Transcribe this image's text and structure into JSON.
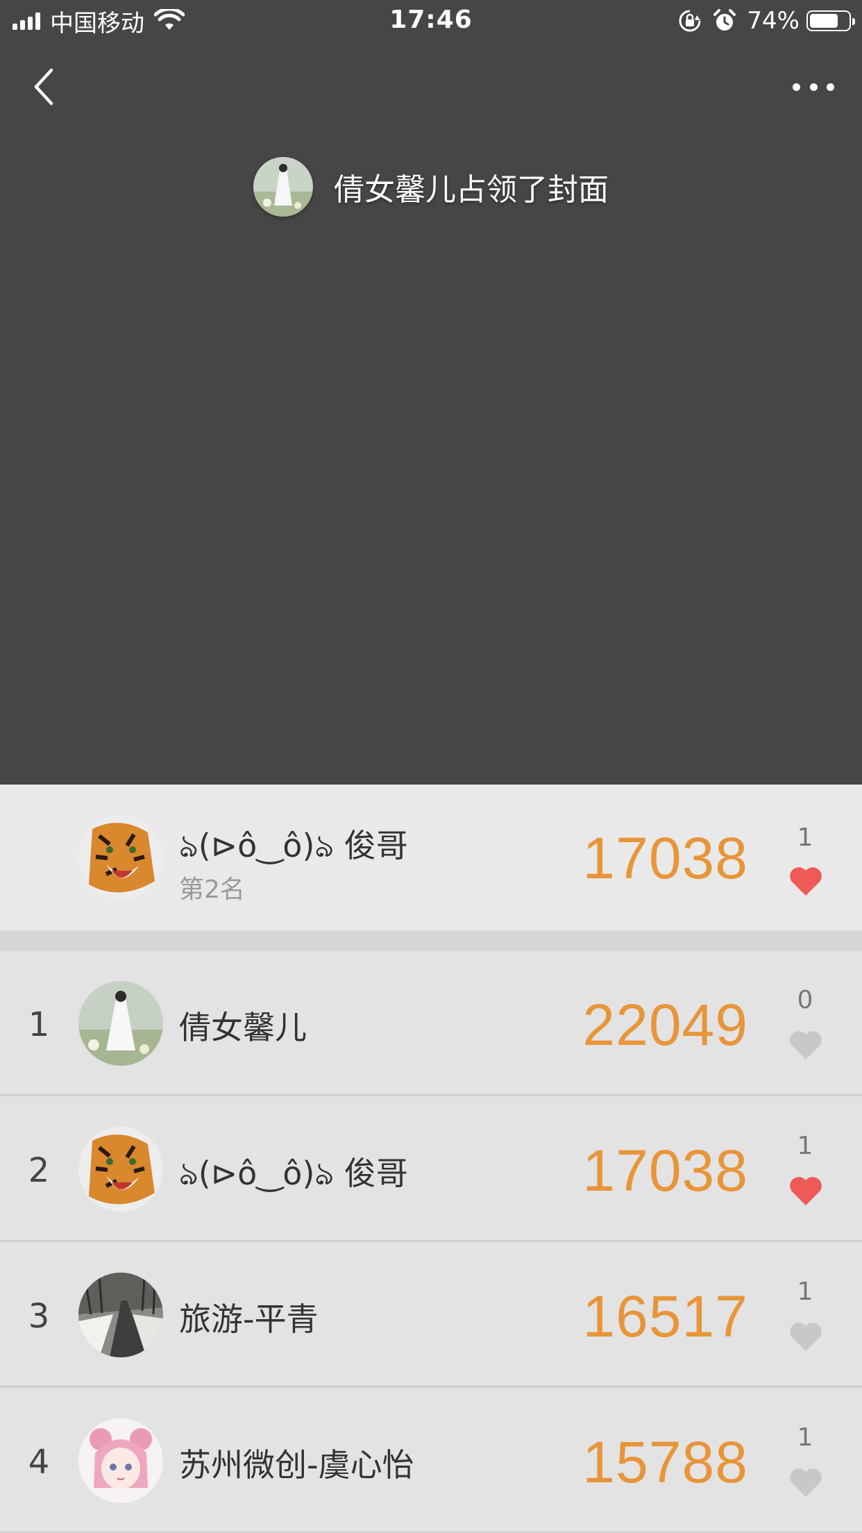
{
  "status_bar": {
    "carrier": "中国移动",
    "time": "17:46",
    "battery_percent": "74%",
    "battery_level": 0.74
  },
  "nav": {
    "back_icon": "chevron-left-icon",
    "more_icon": "more-dots-icon"
  },
  "cover": {
    "owner_text": "倩女馨儿占领了封面"
  },
  "my_entry": {
    "name": "ঌ(⊳ô‿ô)ঌ 俊哥",
    "rank_text": "第2名",
    "score": "17038",
    "likes": "1",
    "liked": true
  },
  "ranking": [
    {
      "rank": "1",
      "name": "倩女馨儿",
      "score": "22049",
      "likes": "0",
      "liked": false,
      "avatar": "girl-avatar"
    },
    {
      "rank": "2",
      "name": "ঌ(⊳ô‿ô)ঌ 俊哥",
      "score": "17038",
      "likes": "1",
      "liked": true,
      "avatar": "tiger-avatar"
    },
    {
      "rank": "3",
      "name": "旅游-平青",
      "score": "16517",
      "likes": "1",
      "liked": false,
      "avatar": "snow-road-avatar"
    },
    {
      "rank": "4",
      "name": "苏州微创-虞心怡",
      "score": "15788",
      "likes": "1",
      "liked": false,
      "avatar": "anime-girl-avatar"
    }
  ],
  "colors": {
    "cover_bg": "#464646",
    "score": "#e8953a",
    "heart_liked": "#ee5a56",
    "heart_unliked": "#c8c8c8"
  }
}
